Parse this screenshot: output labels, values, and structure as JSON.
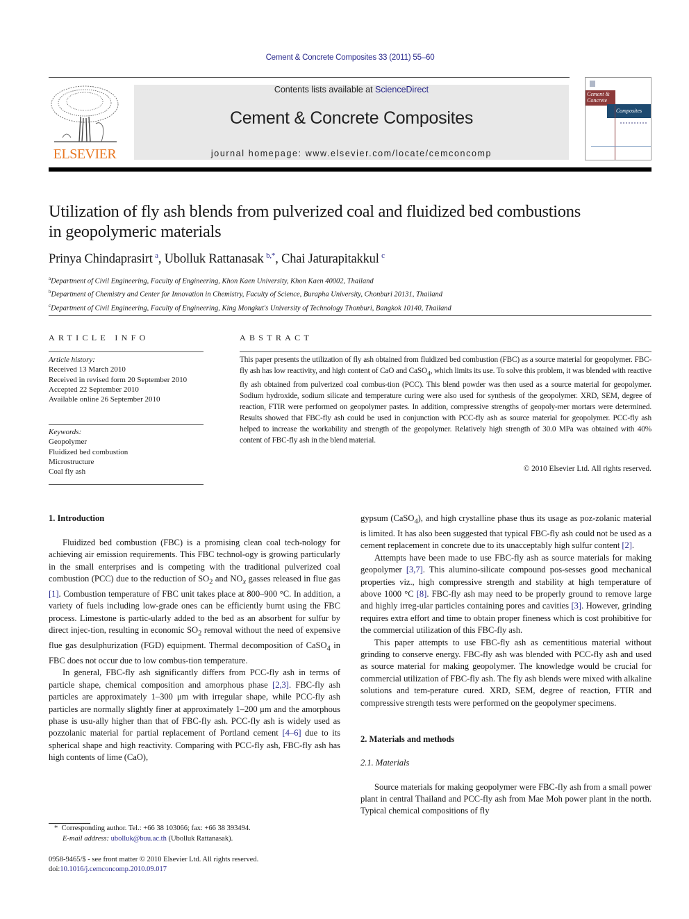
{
  "header": {
    "journal_ref": "Cement & Concrete Composites 33 (2011) 55–60",
    "contents_prefix": "Contents lists available at ",
    "contents_link": "ScienceDirect",
    "journal_title": "Cement & Concrete Composites",
    "homepage": "journal homepage: www.elsevier.com/locate/cemconcomp",
    "publisher_logo_text": "ELSEVIER",
    "cover": {
      "line1": "Cement &",
      "line2": "Concrete",
      "line3": "Composites"
    },
    "colors": {
      "publisher_orange": "#e87722",
      "link_blue": "#2a2a8c",
      "banner_gray": "#e8e8e8",
      "cover_red": "#8c3a3a",
      "cover_blue": "#1e4a70"
    }
  },
  "article": {
    "title_line1": "Utilization of fly ash blends from pulverized coal and fluidized bed combustions",
    "title_line2": "in geopolymeric materials",
    "authors": [
      {
        "name": "Prinya Chindaprasirt",
        "sup": "a"
      },
      {
        "name": "Ubolluk Rattanasak",
        "sup": "b,*"
      },
      {
        "name": "Chai Jaturapitakkul",
        "sup": "c"
      }
    ],
    "affiliations": [
      {
        "sup": "a",
        "text": "Department of Civil Engineering, Faculty of Engineering, Khon Kaen University, Khon Kaen 40002, Thailand"
      },
      {
        "sup": "b",
        "text": "Department of Chemistry and Center for Innovation in Chemistry, Faculty of Science, Burapha University, Chonburi 20131, Thailand"
      },
      {
        "sup": "c",
        "text": "Department of Civil Engineering, Faculty of Engineering, King Mongkut's University of Technology Thonburi, Bangkok 10140, Thailand"
      }
    ]
  },
  "article_info": {
    "label": "ARTICLE INFO",
    "history_label": "Article history:",
    "history": [
      "Received 13 March 2010",
      "Received in revised form 20 September 2010",
      "Accepted 22 September 2010",
      "Available online 26 September 2010"
    ],
    "keywords_label": "Keywords:",
    "keywords": [
      "Geopolymer",
      "Fluidized bed combustion",
      "Microstructure",
      "Coal fly ash"
    ]
  },
  "abstract": {
    "label": "ABSTRACT",
    "p1": "This paper presents the utilization of fly ash obtained from fluidized bed combustion (FBC) as a source material for geopolymer. FBC-fly ash has low reactivity, and high content of CaO and CaSO",
    "p1_sub": "4",
    "p2": ", which limits its use. To solve this problem, it was blended with reactive fly ash obtained from pulverized coal combus-tion (PCC). This blend powder was then used as a source material for geopolymer. Sodium hydroxide, sodium silicate and temperature curing were also used for synthesis of the geopolymer. XRD, SEM, degree of reaction, FTIR were performed on geopolymer pastes. In addition, compressive strengths of geopoly-mer mortars were determined. Results showed that FBC-fly ash could be used in conjunction with PCC-fly ash as source material for geopolymer. PCC-fly ash helped to increase the workability and strength of the geopolymer. Relatively high strength of 30.0 MPa was obtained with 40% content of FBC-fly ash in the blend material.",
    "copyright": "© 2010 Elsevier Ltd. All rights reserved."
  },
  "body": {
    "sec1_heading": "1. Introduction",
    "intro_p1": [
      "Fluidized bed combustion (FBC) is a promising clean coal tech-nology for achieving air emission requirements. This FBC technol-ogy is growing particularly in the small enterprises and is competing with the traditional pulverized coal combustion (PCC) due to the reduction of SO",
      "2",
      " and NO",
      "x",
      " gasses released in flue gas ",
      "[1]",
      ". Combustion temperature of FBC unit takes place at 800–900 °C. In addition, a variety of fuels including low-grade ones can be efficiently burnt using the FBC process. Limestone is partic-ularly added to the bed as an absorbent for sulfur by direct injec-tion, resulting in economic SO",
      "2",
      " removal without the need of expensive flue gas desulphurization (FGD) equipment. Thermal decomposition of CaSO",
      "4",
      " in FBC does not occur due to low combus-tion temperature."
    ],
    "intro_p2": [
      "In general, FBC-fly ash significantly differs from PCC-fly ash in terms of particle shape, chemical composition and amorphous phase ",
      "[2,3]",
      ". FBC-fly ash particles are approximately 1–300 μm with irregular shape, while PCC-fly ash particles are normally slightly finer at approximately 1–200 μm and the amorphous phase is usu-ally higher than that of FBC-fly ash. PCC-fly ash is widely used as pozzolanic material for partial replacement of Portland cement ",
      "[4–6]",
      " due to its spherical shape and high reactivity. Comparing with PCC-fly ash, FBC-fly ash has high contents of lime (CaO), gypsum (CaSO",
      "4",
      "), and high crystalline phase thus its usage as poz-zolanic material is limited. It has also been suggested that typical FBC-fly ash could not be used as a cement replacement in concrete due to its unacceptably high sulfur content ",
      "[2]",
      "."
    ],
    "intro_p3": [
      "Attempts have been made to use FBC-fly ash as source materials for making geopolymer ",
      "[3,7]",
      ". This alumino-silicate compound pos-sesses good mechanical properties viz., high compressive strength and stability at high temperature of above 1000 °C ",
      "[8]",
      ". FBC-fly ash may need to be properly ground to remove large and highly irreg-ular particles containing pores and cavities ",
      "[3]",
      ". However, grinding requires extra effort and time to obtain proper fineness which is cost prohibitive for the commercial utilization of this FBC-fly ash."
    ],
    "intro_p4": "This paper attempts to use FBC-fly ash as cementitious material without grinding to conserve energy. FBC-fly ash was blended with PCC-fly ash and used as source material for making geopolymer. The knowledge would be crucial for commercial utilization of FBC-fly ash. The fly ash blends were mixed with alkaline solutions and tem-perature cured. XRD, SEM, degree of reaction, FTIR and compressive strength tests were performed on the geopolymer specimens.",
    "sec2_heading": "2. Materials and methods",
    "sec21_heading": "2.1. Materials",
    "materials_p1": "Source materials for making geopolymer were FBC-fly ash from a small power plant in central Thailand and PCC-fly ash from Mae Moh power plant in the north. Typical chemical compositions of fly"
  },
  "footer": {
    "footnote_marker": "*",
    "footnote_line1": "Corresponding author. Tel.: +66 38 103066; fax: +66 38 393494.",
    "email_label": "E-mail address:",
    "email": "ubolluk@buu.ac.th",
    "email_suffix": " (Ubolluk Rattanasak).",
    "issn": "0958-9465/$ - see front matter © 2010 Elsevier Ltd. All rights reserved.",
    "doi_prefix": "doi:",
    "doi": "10.1016/j.cemconcomp.2010.09.017"
  }
}
